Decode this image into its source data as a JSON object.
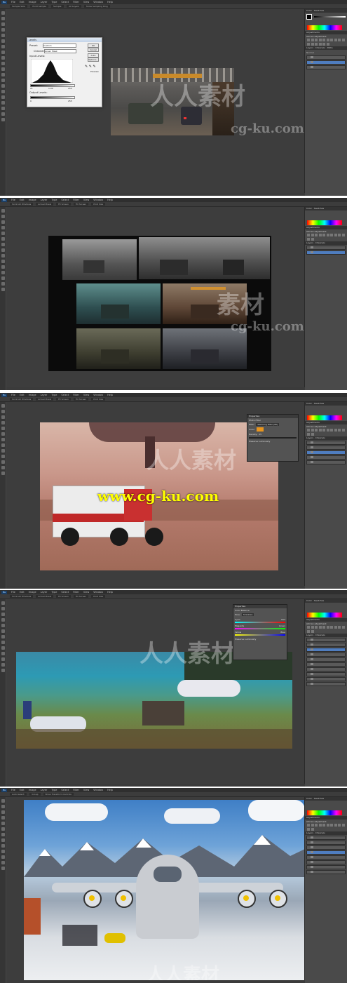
{
  "menu": {
    "ps_logo": "Ps",
    "items": [
      "File",
      "Edit",
      "Image",
      "Layer",
      "Type",
      "Select",
      "Filter",
      "View",
      "Window",
      "Help"
    ]
  },
  "options_bar": {
    "items": [
      "Sample Size:",
      "Point Sample",
      "Sample:",
      "All Layers",
      "Show Sampling Ring"
    ]
  },
  "options_bar_2": {
    "items": [
      "Scroll All Windows",
      "Actual Pixels",
      "Fit Screen",
      "Fill Screen",
      "Print Size"
    ]
  },
  "options_bar_5": {
    "items": [
      "Auto-Select:",
      "Group",
      "Show Transform Controls"
    ]
  },
  "panels": {
    "color_tab": "Color",
    "swatches_tab": "Swatches",
    "adjustments_tab": "Adjustments",
    "add_adjustment": "Add an adjustment",
    "layers_tab": "Layers",
    "channels_tab": "Channels",
    "paths_tab": "Paths",
    "blend_mode": "Normal",
    "opacity_label": "Opacity:",
    "fill_label": "Fill:"
  },
  "levels_dialog": {
    "title": "Levels",
    "preset_label": "Preset:",
    "preset_value": "Custom",
    "channel_label": "Channel:",
    "channel_value": "Green Mask",
    "input_label": "Input Levels:",
    "output_label": "Output Levels:",
    "ok": "OK",
    "cancel": "Cancel",
    "auto": "Auto",
    "options": "Options...",
    "preview": "Preview",
    "in_low": "21",
    "in_mid": "1.00",
    "in_high": "255",
    "out_low": "0",
    "out_high": "255"
  },
  "props_photo_filter": {
    "title": "Properties",
    "adj_name": "Photo Filter",
    "filter_label": "Filter:",
    "filter_value": "Warming Filter (85)",
    "color_label": "Color:",
    "density_label": "Density:",
    "density_value": "25",
    "preserve": "Preserve Luminosity"
  },
  "props_color_balance": {
    "title": "Properties",
    "adj_name": "Color Balance",
    "tone_label": "Tone:",
    "tone_value": "Shadows",
    "cyan": "Cyan",
    "red": "Red",
    "magenta": "Magenta",
    "green": "Green",
    "yellow": "Yellow",
    "blue": "Blue",
    "preserve": "Preserve Luminosity"
  },
  "watermarks": {
    "logo_cn": "人人素材",
    "logo_cn_2": "素材",
    "site": "cg-ku.com",
    "yellow_site": "www.cg-ku.com"
  },
  "colors": {
    "panel_bg": "#4a4a4a",
    "menubar_bg": "#2f2f2f",
    "canvas_bg": "#272727",
    "selected_layer": "#4f7dbf",
    "photo_filter_color": "#e8951e"
  }
}
